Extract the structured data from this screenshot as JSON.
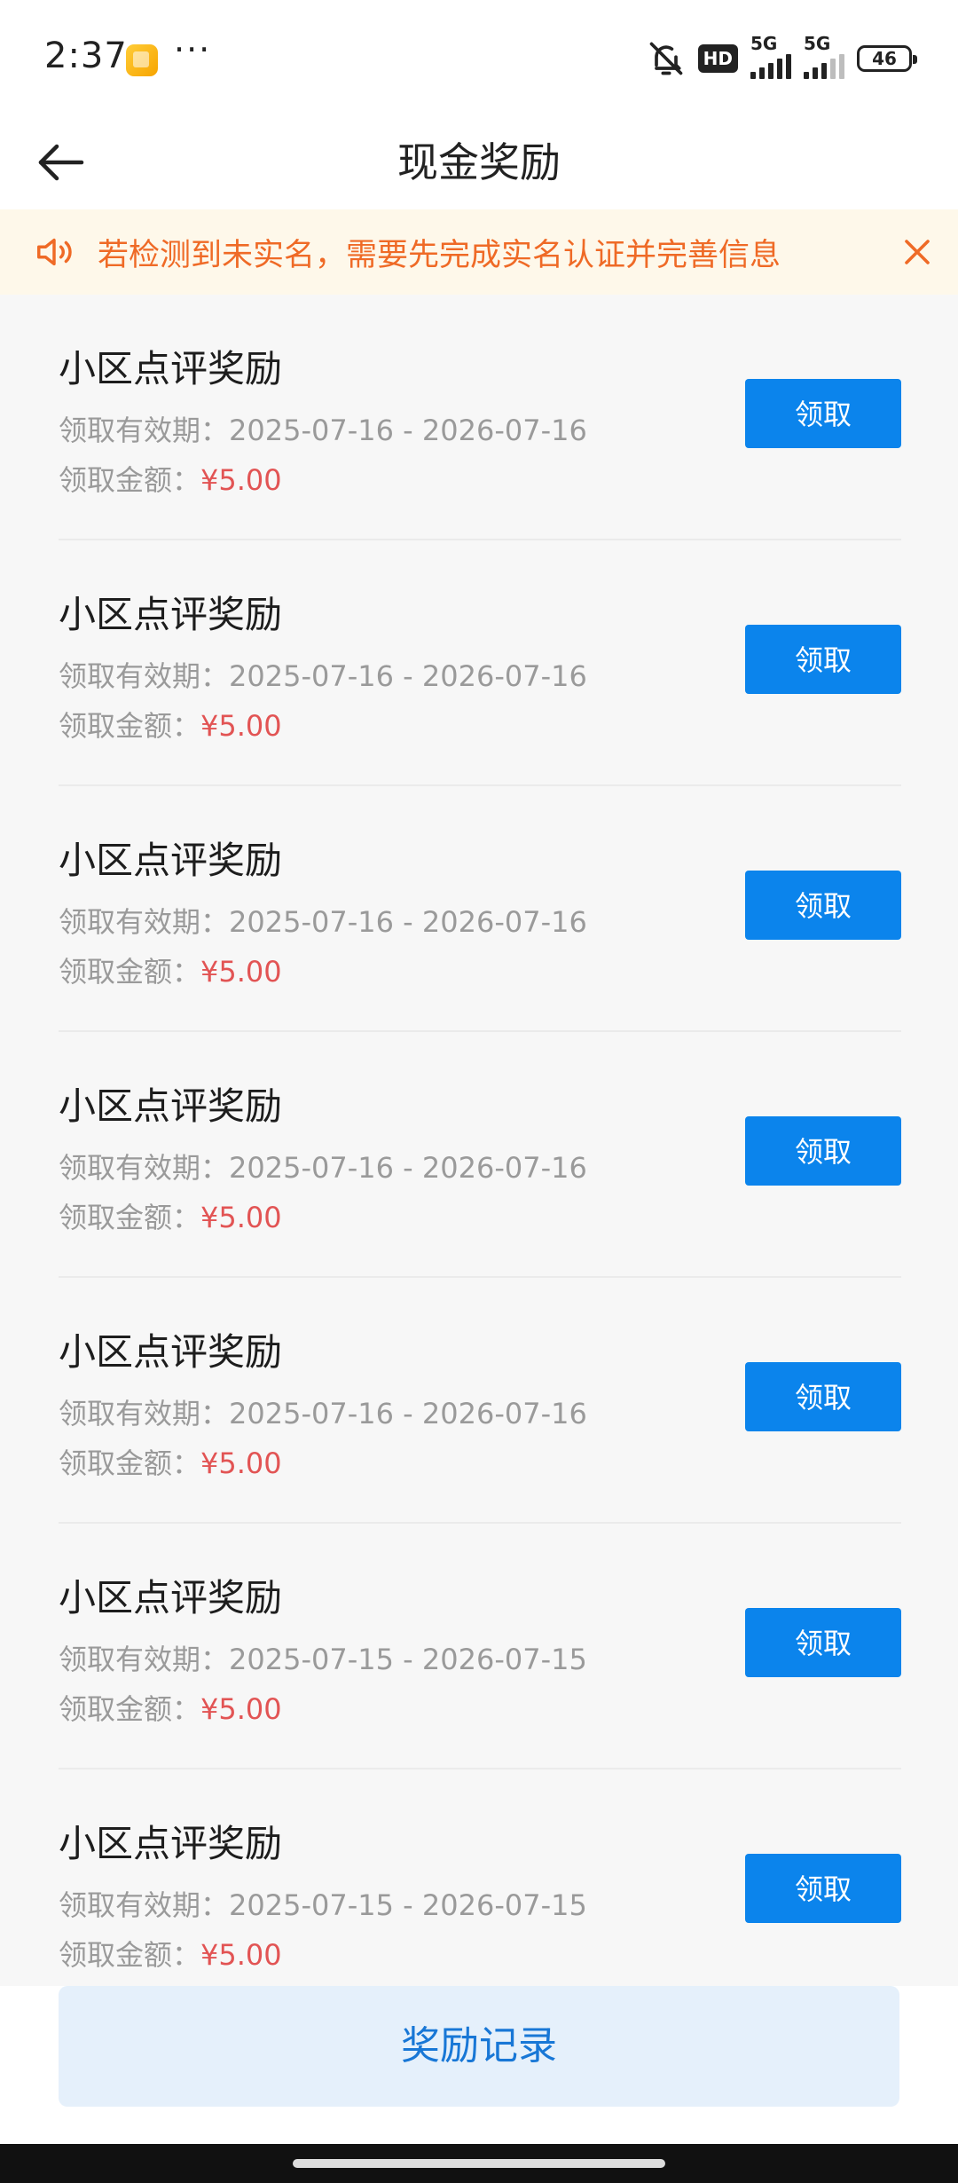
{
  "status_bar": {
    "time": "2:37",
    "more": "···",
    "hd": "HD",
    "sim1_label": "5G",
    "sim2_label": "5G",
    "battery": "46"
  },
  "header": {
    "title": "现金奖励"
  },
  "notice": {
    "text": "若检测到未实名，需要先完成实名认证并完善信息"
  },
  "rewards": [
    {
      "title": "小区点评奖励",
      "valid_label": "领取有效期：",
      "valid_range": "2025-07-16 - 2026-07-16",
      "amount_label": "领取金额：",
      "amount": "¥5.00",
      "button": "领取"
    },
    {
      "title": "小区点评奖励",
      "valid_label": "领取有效期：",
      "valid_range": "2025-07-16 - 2026-07-16",
      "amount_label": "领取金额：",
      "amount": "¥5.00",
      "button": "领取"
    },
    {
      "title": "小区点评奖励",
      "valid_label": "领取有效期：",
      "valid_range": "2025-07-16 - 2026-07-16",
      "amount_label": "领取金额：",
      "amount": "¥5.00",
      "button": "领取"
    },
    {
      "title": "小区点评奖励",
      "valid_label": "领取有效期：",
      "valid_range": "2025-07-16 - 2026-07-16",
      "amount_label": "领取金额：",
      "amount": "¥5.00",
      "button": "领取"
    },
    {
      "title": "小区点评奖励",
      "valid_label": "领取有效期：",
      "valid_range": "2025-07-16 - 2026-07-16",
      "amount_label": "领取金额：",
      "amount": "¥5.00",
      "button": "领取"
    },
    {
      "title": "小区点评奖励",
      "valid_label": "领取有效期：",
      "valid_range": "2025-07-15 - 2026-07-15",
      "amount_label": "领取金额：",
      "amount": "¥5.00",
      "button": "领取"
    },
    {
      "title": "小区点评奖励",
      "valid_label": "领取有效期：",
      "valid_range": "2025-07-15 - 2026-07-15",
      "amount_label": "领取金额：",
      "amount": "¥5.00",
      "button": "领取"
    }
  ],
  "footer": {
    "record_button": "奖励记录"
  },
  "colors": {
    "accent_blue": "#0b84ec",
    "amount_red": "#e25454",
    "notice_orange": "#ef6a26",
    "notice_bg": "#fef8ea",
    "record_bg": "#e5f0fb"
  }
}
